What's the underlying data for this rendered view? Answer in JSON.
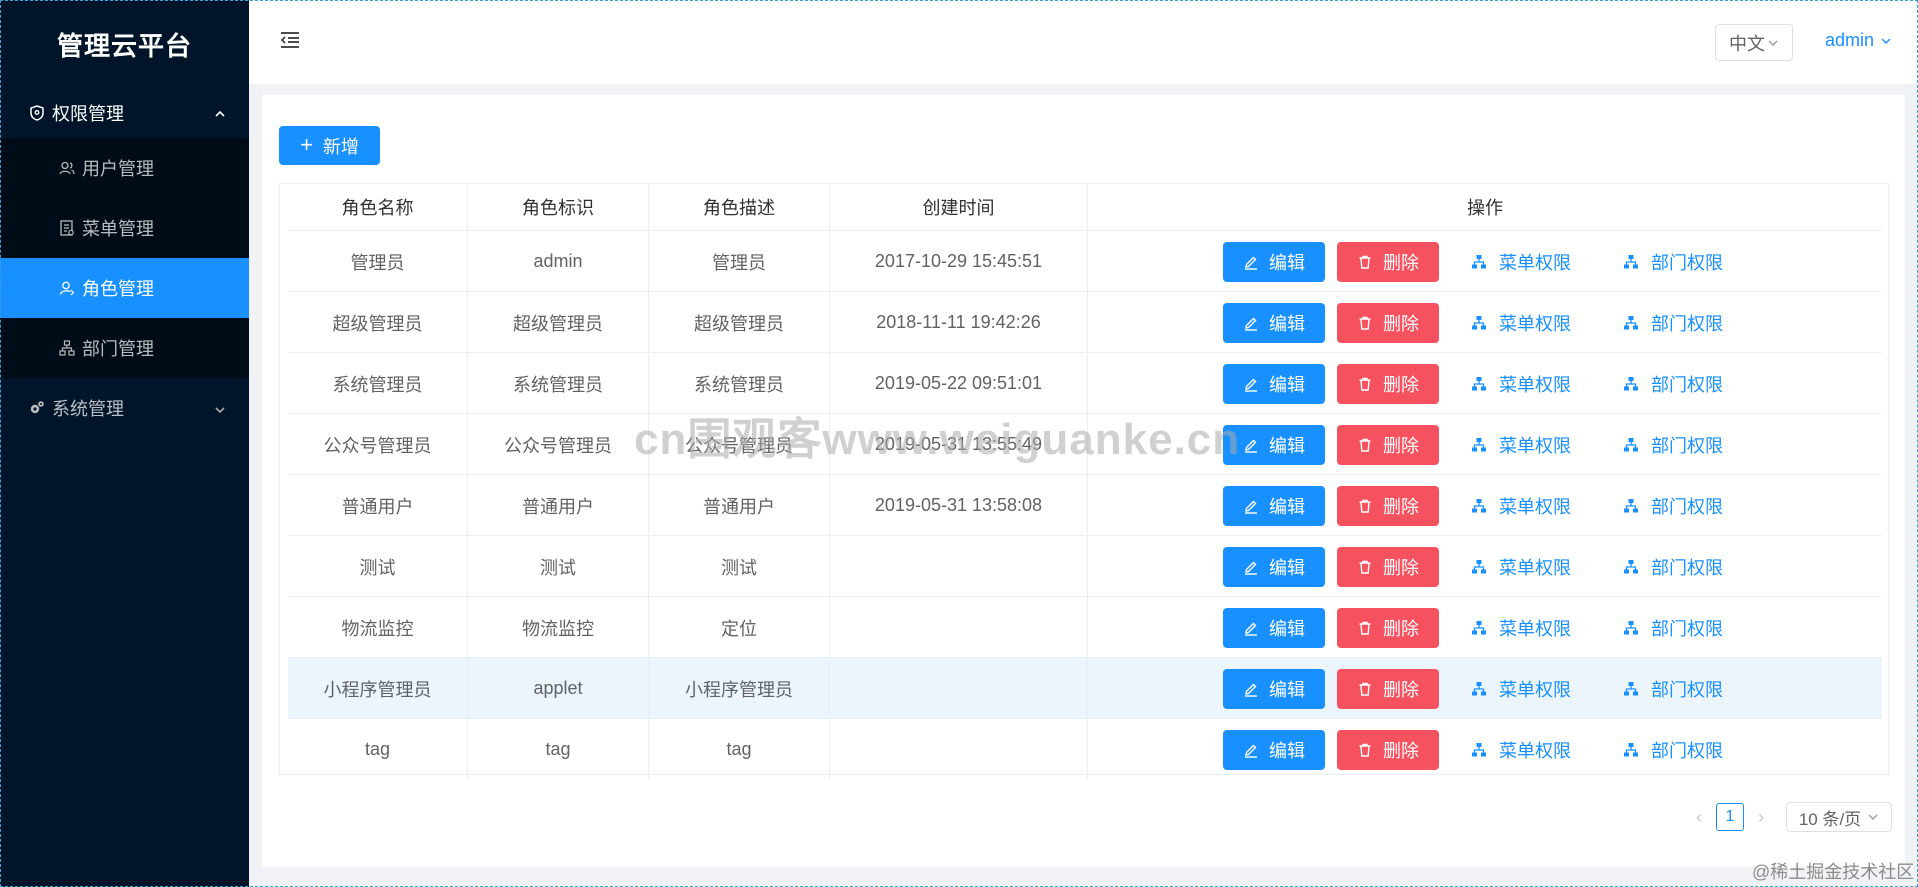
{
  "app": {
    "title": "管理云平台"
  },
  "sidebar": {
    "groups": [
      {
        "label": "权限管理",
        "icon": "shield-icon",
        "expanded": true,
        "items": [
          {
            "label": "用户管理",
            "icon": "user-icon"
          },
          {
            "label": "菜单管理",
            "icon": "menu-doc-icon"
          },
          {
            "label": "角色管理",
            "icon": "role-icon",
            "active": true
          },
          {
            "label": "部门管理",
            "icon": "org-icon"
          }
        ]
      },
      {
        "label": "系统管理",
        "icon": "cogs-icon",
        "expanded": false
      }
    ]
  },
  "header": {
    "lang": "中文",
    "user": "admin"
  },
  "toolbar": {
    "add_label": "新增"
  },
  "table": {
    "columns": [
      "角色名称",
      "角色标识",
      "角色描述",
      "创建时间",
      "操作"
    ],
    "rows": [
      {
        "name": "管理员",
        "key": "admin",
        "desc": "管理员",
        "time": "2017-10-29 15:45:51"
      },
      {
        "name": "超级管理员",
        "key": "超级管理员",
        "desc": "超级管理员",
        "time": "2018-11-11 19:42:26"
      },
      {
        "name": "系统管理员",
        "key": "系统管理员",
        "desc": "系统管理员",
        "time": "2019-05-22 09:51:01"
      },
      {
        "name": "公众号管理员",
        "key": "公众号管理员",
        "desc": "公众号管理员",
        "time": "2019-05-31 13:55:49"
      },
      {
        "name": "普通用户",
        "key": "普通用户",
        "desc": "普通用户",
        "time": "2019-05-31 13:58:08"
      },
      {
        "name": "测试",
        "key": "测试",
        "desc": "测试",
        "time": ""
      },
      {
        "name": "物流监控",
        "key": "物流监控",
        "desc": "定位",
        "time": ""
      },
      {
        "name": "小程序管理员",
        "key": "applet",
        "desc": "小程序管理员",
        "time": "",
        "highlighted": true
      },
      {
        "name": "tag",
        "key": "tag",
        "desc": "tag",
        "time": ""
      }
    ],
    "actions": {
      "edit": "编辑",
      "delete": "删除",
      "menu_perm": "菜单权限",
      "dept_perm": "部门权限"
    }
  },
  "pagination": {
    "current": "1",
    "page_size": "10 条/页"
  },
  "overlays": {
    "watermark": "cn围观客www.weiguanke.cn",
    "corner": "@稀土掘金技术社区"
  },
  "colors": {
    "primary": "#1890ff",
    "danger": "#f5515f",
    "sidebar": "#001529",
    "submenu": "#000c17"
  }
}
